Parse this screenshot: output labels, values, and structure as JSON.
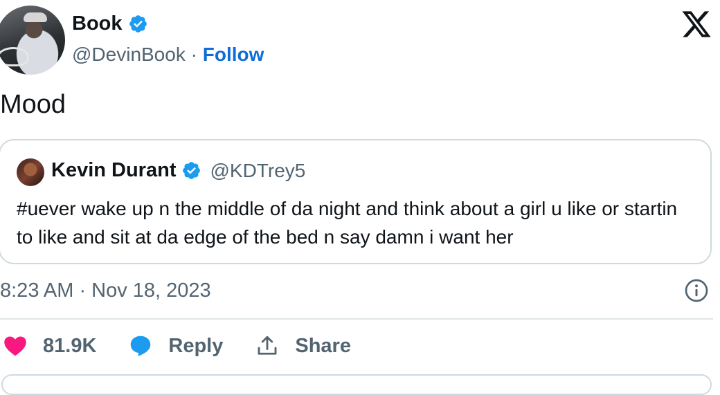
{
  "author": {
    "name": "Book",
    "handle": "@DevinBook",
    "separator": "·",
    "follow_label": "Follow"
  },
  "tweet": {
    "text": "Mood"
  },
  "quoted": {
    "name": "Kevin Durant",
    "handle": "@KDTrey5",
    "text": "#uever wake up n the middle of da night and think about a girl u like or startin to like and sit at da edge of the bed n say damn i want her"
  },
  "meta": {
    "timestamp": "8:23 AM · Nov 18, 2023"
  },
  "actions": {
    "likes": "81.9K",
    "reply_label": "Reply",
    "share_label": "Share"
  },
  "colors": {
    "accent": "#1d9bf0",
    "follow": "#0f6dd4",
    "like": "#f91880",
    "secondary_text": "#536471",
    "border": "#cfd9de"
  },
  "icons": [
    "verified-badge-icon",
    "x-logo-icon",
    "info-icon",
    "heart-icon",
    "reply-bubble-icon",
    "share-icon"
  ]
}
